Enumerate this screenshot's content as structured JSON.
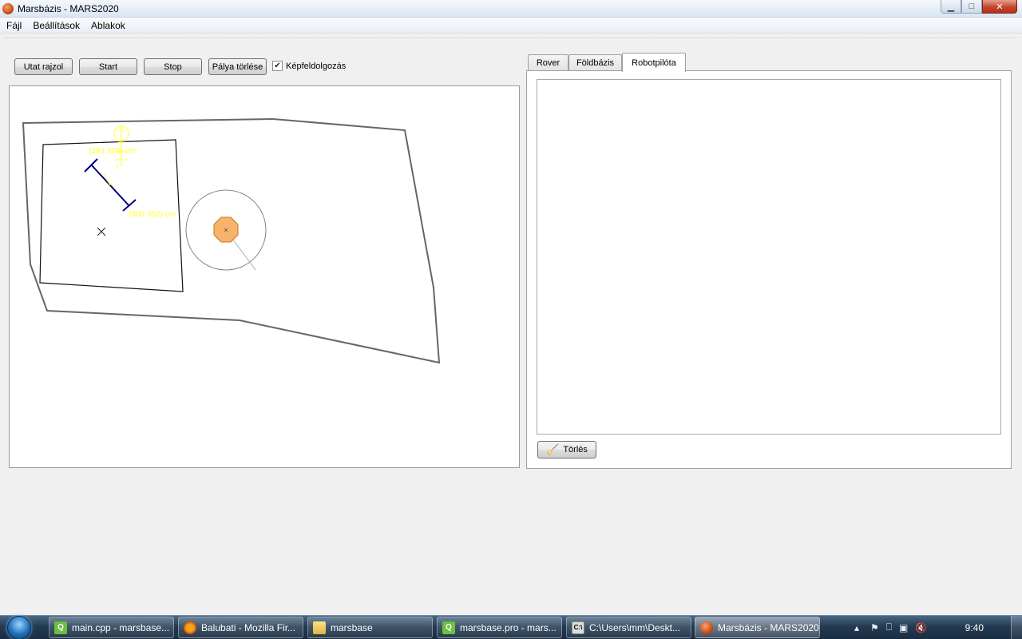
{
  "window": {
    "title": "Marsbázis - MARS2020"
  },
  "menu": [
    "Fájl",
    "Beállítások",
    "Ablakok"
  ],
  "toolbar": {
    "draw_path": "Utat rajzol",
    "start": "Start",
    "stop": "Stop",
    "clear_track": "Pálya törlése",
    "image_processing": "Képfeldolgozás",
    "image_processing_checked": true
  },
  "map": {
    "robot_label": "(284 320) cm",
    "target_label": "(300 302) cm"
  },
  "tabs": [
    {
      "label": "Rover",
      "active": false
    },
    {
      "label": "Földbázis",
      "active": false
    },
    {
      "label": "Robotpilóta",
      "active": true
    }
  ],
  "panel": {
    "clear_button": "Törlés",
    "log_text": ""
  },
  "taskbar": {
    "items": [
      {
        "label": "main.cpp - marsbase...",
        "icon": "qt-creator-icon"
      },
      {
        "label": "Balubati - Mozilla Fir...",
        "icon": "firefox-icon"
      },
      {
        "label": "marsbase",
        "icon": "folder-icon"
      },
      {
        "label": "marsbase.pro - mars...",
        "icon": "qt-creator-icon"
      },
      {
        "label": "C:\\Users\\mm\\Deskt...",
        "icon": "command-prompt-icon"
      },
      {
        "label": "Marsbázis - MARS2020",
        "icon": "marsbase-app-icon"
      }
    ],
    "clock": "9:40"
  },
  "colors": {
    "annotation": "#ffff33",
    "path_segment": "#000080",
    "rover_fill": "#f7b26b",
    "rover_stroke": "#c8781c"
  }
}
